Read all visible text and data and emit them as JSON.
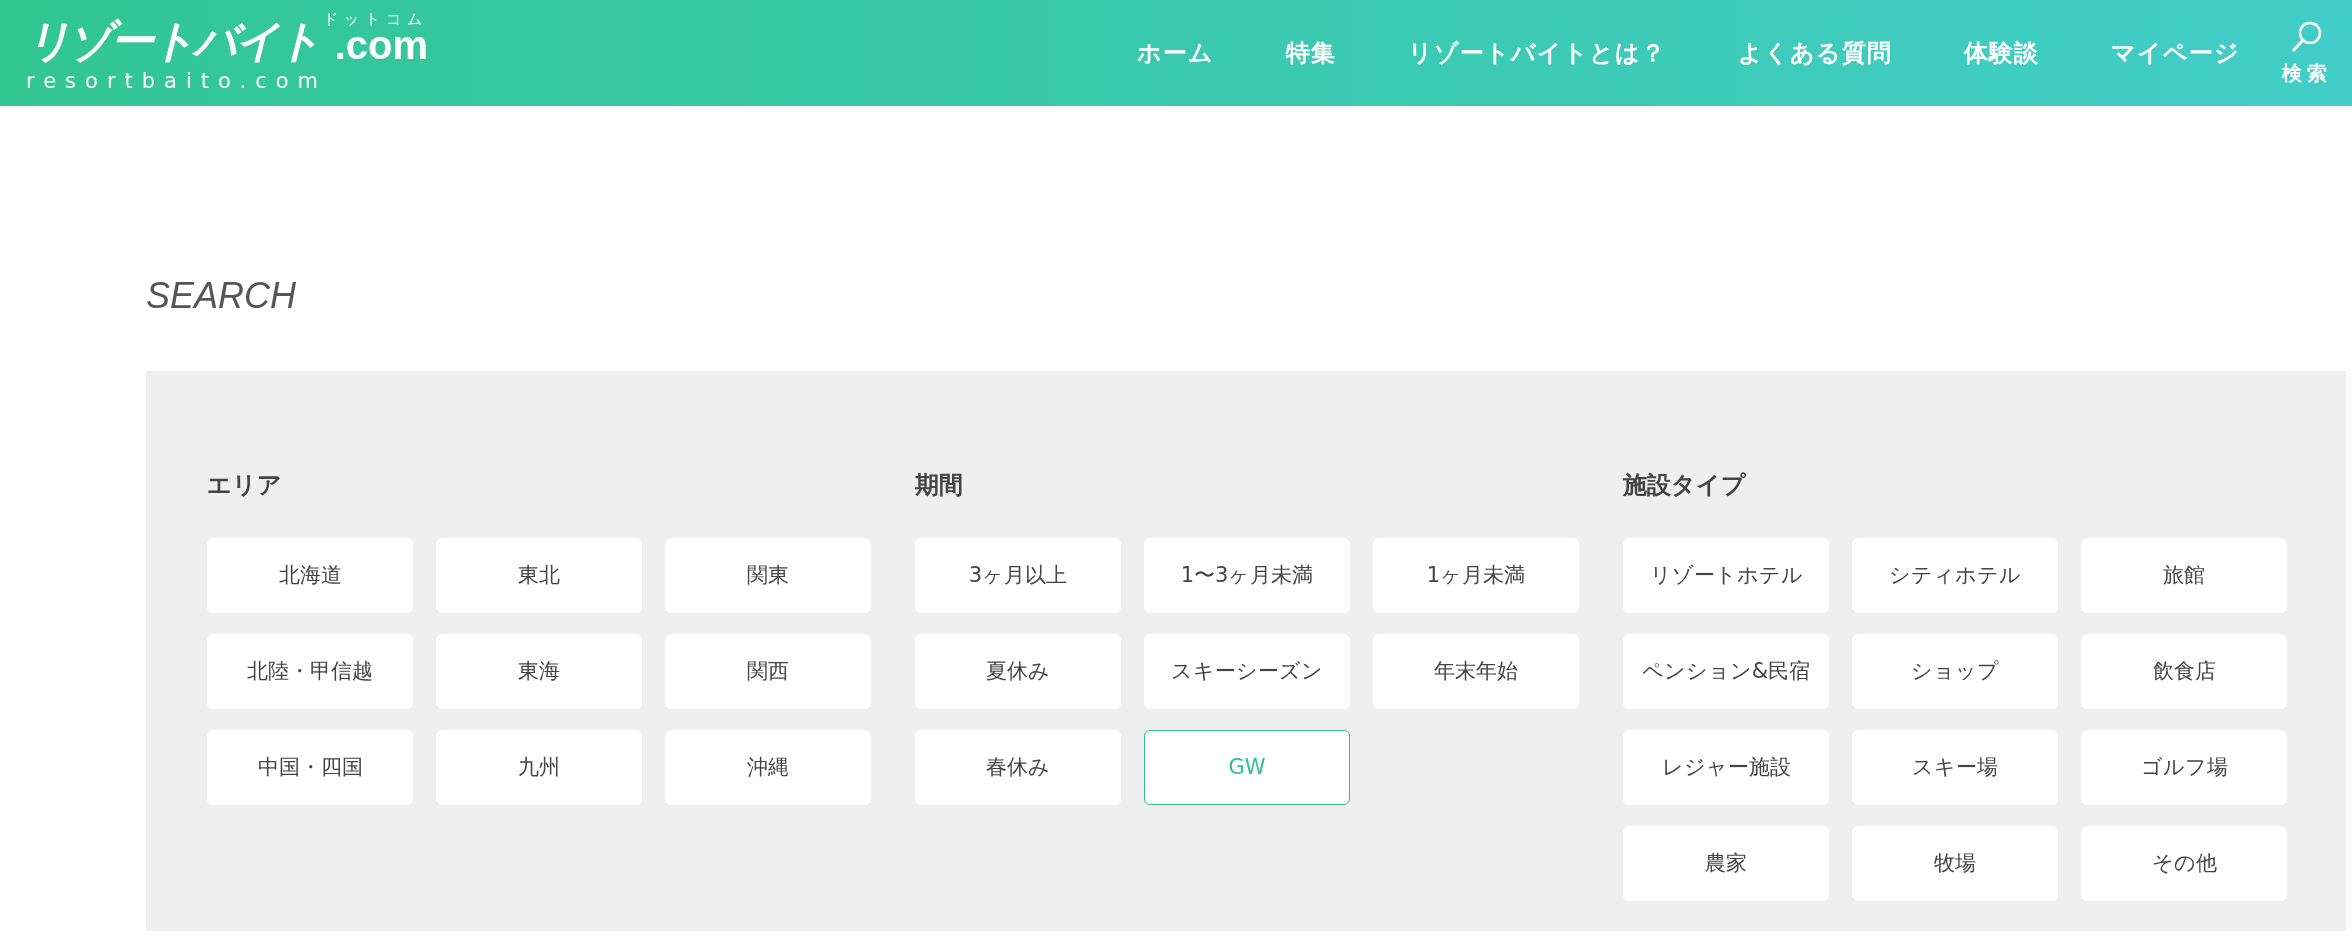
{
  "header": {
    "logo": {
      "main": "リゾートバイト",
      "suffix": ".com",
      "kana": "ドットコム",
      "domain": "resortbaito.com"
    },
    "nav": [
      {
        "label": "ホーム"
      },
      {
        "label": "特集"
      },
      {
        "label": "リゾートバイトとは？"
      },
      {
        "label": "よくある質問"
      },
      {
        "label": "体験談"
      },
      {
        "label": "マイページ"
      }
    ],
    "search": {
      "label": "検索"
    }
  },
  "heading": "SEARCH",
  "sections": [
    {
      "title": "エリア",
      "options": [
        {
          "label": "北海道",
          "selected": false
        },
        {
          "label": "東北",
          "selected": false
        },
        {
          "label": "関東",
          "selected": false
        },
        {
          "label": "北陸・甲信越",
          "selected": false
        },
        {
          "label": "東海",
          "selected": false
        },
        {
          "label": "関西",
          "selected": false
        },
        {
          "label": "中国・四国",
          "selected": false
        },
        {
          "label": "九州",
          "selected": false
        },
        {
          "label": "沖縄",
          "selected": false
        }
      ]
    },
    {
      "title": "期間",
      "options": [
        {
          "label": "3ヶ月以上",
          "selected": false
        },
        {
          "label": "1〜3ヶ月未満",
          "selected": false
        },
        {
          "label": "1ヶ月未満",
          "selected": false
        },
        {
          "label": "夏休み",
          "selected": false
        },
        {
          "label": "スキーシーズン",
          "selected": false
        },
        {
          "label": "年末年始",
          "selected": false
        },
        {
          "label": "春休み",
          "selected": false
        },
        {
          "label": "GW",
          "selected": true
        }
      ]
    },
    {
      "title": "施設タイプ",
      "options": [
        {
          "label": "リゾートホテル",
          "selected": false
        },
        {
          "label": "シティホテル",
          "selected": false
        },
        {
          "label": "旅館",
          "selected": false
        },
        {
          "label": "ペンション&民宿",
          "selected": false
        },
        {
          "label": "ショップ",
          "selected": false
        },
        {
          "label": "飲食店",
          "selected": false
        },
        {
          "label": "レジャー施設",
          "selected": false
        },
        {
          "label": "スキー場",
          "selected": false
        },
        {
          "label": "ゴルフ場",
          "selected": false
        },
        {
          "label": "農家",
          "selected": false
        },
        {
          "label": "牧場",
          "selected": false
        },
        {
          "label": "その他",
          "selected": false
        }
      ]
    }
  ]
}
